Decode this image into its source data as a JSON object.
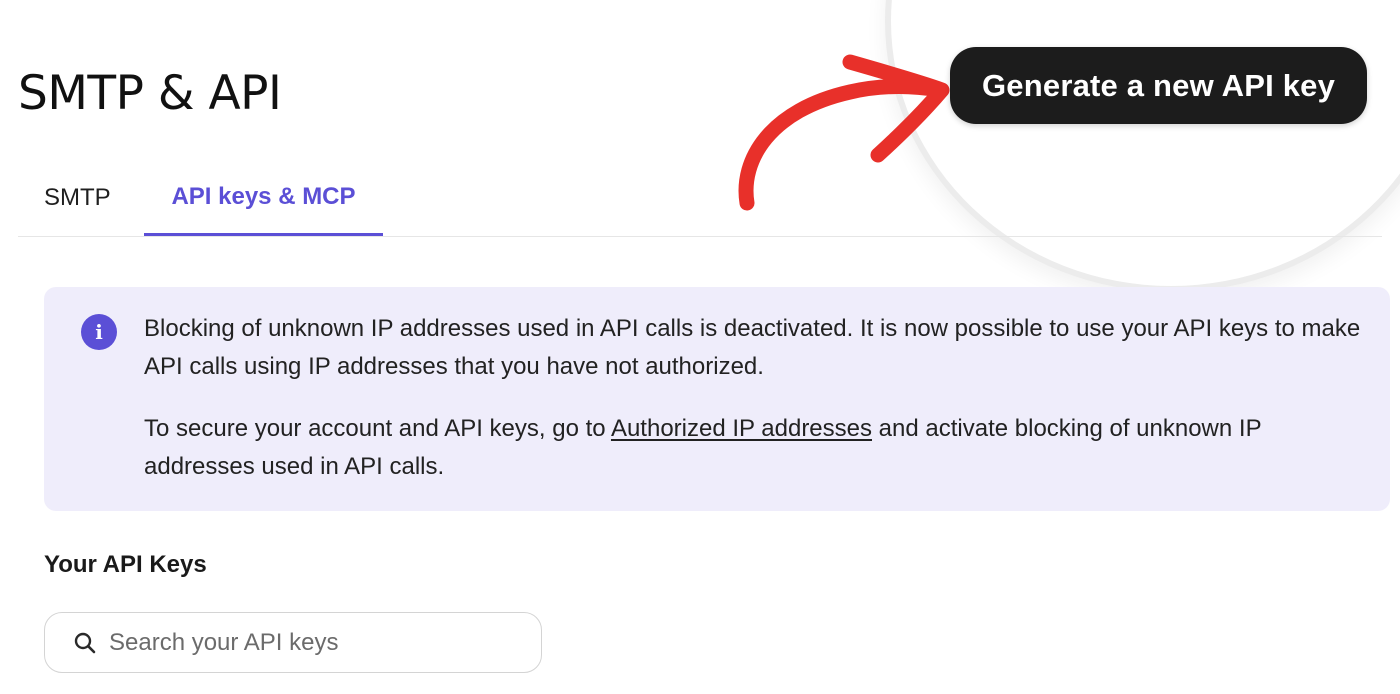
{
  "page": {
    "title": "SMTP & API"
  },
  "header": {
    "generate_button_label": "Generate a new API key"
  },
  "tabs": [
    {
      "label": "SMTP",
      "active": false
    },
    {
      "label": "API keys & MCP",
      "active": true
    }
  ],
  "notice": {
    "icon": "info-icon",
    "icon_glyph": "i",
    "paragraph1": "Blocking of unknown IP addresses used in API calls is deactivated. It is now possible to use your API keys to make API calls using IP addresses that you have not authorized.",
    "paragraph2_before": "To secure your account and API keys, go to ",
    "paragraph2_link": "Authorized IP addresses",
    "paragraph2_after": " and activate blocking of unknown IP addresses used in API calls."
  },
  "api_keys": {
    "section_title": "Your API Keys",
    "search_placeholder": "Search your API keys",
    "search_value": ""
  },
  "colors": {
    "accent": "#5b4fd6",
    "notice_background": "#efedfb",
    "button_background": "#1c1c1c",
    "annotation_arrow": "#e8302a"
  }
}
